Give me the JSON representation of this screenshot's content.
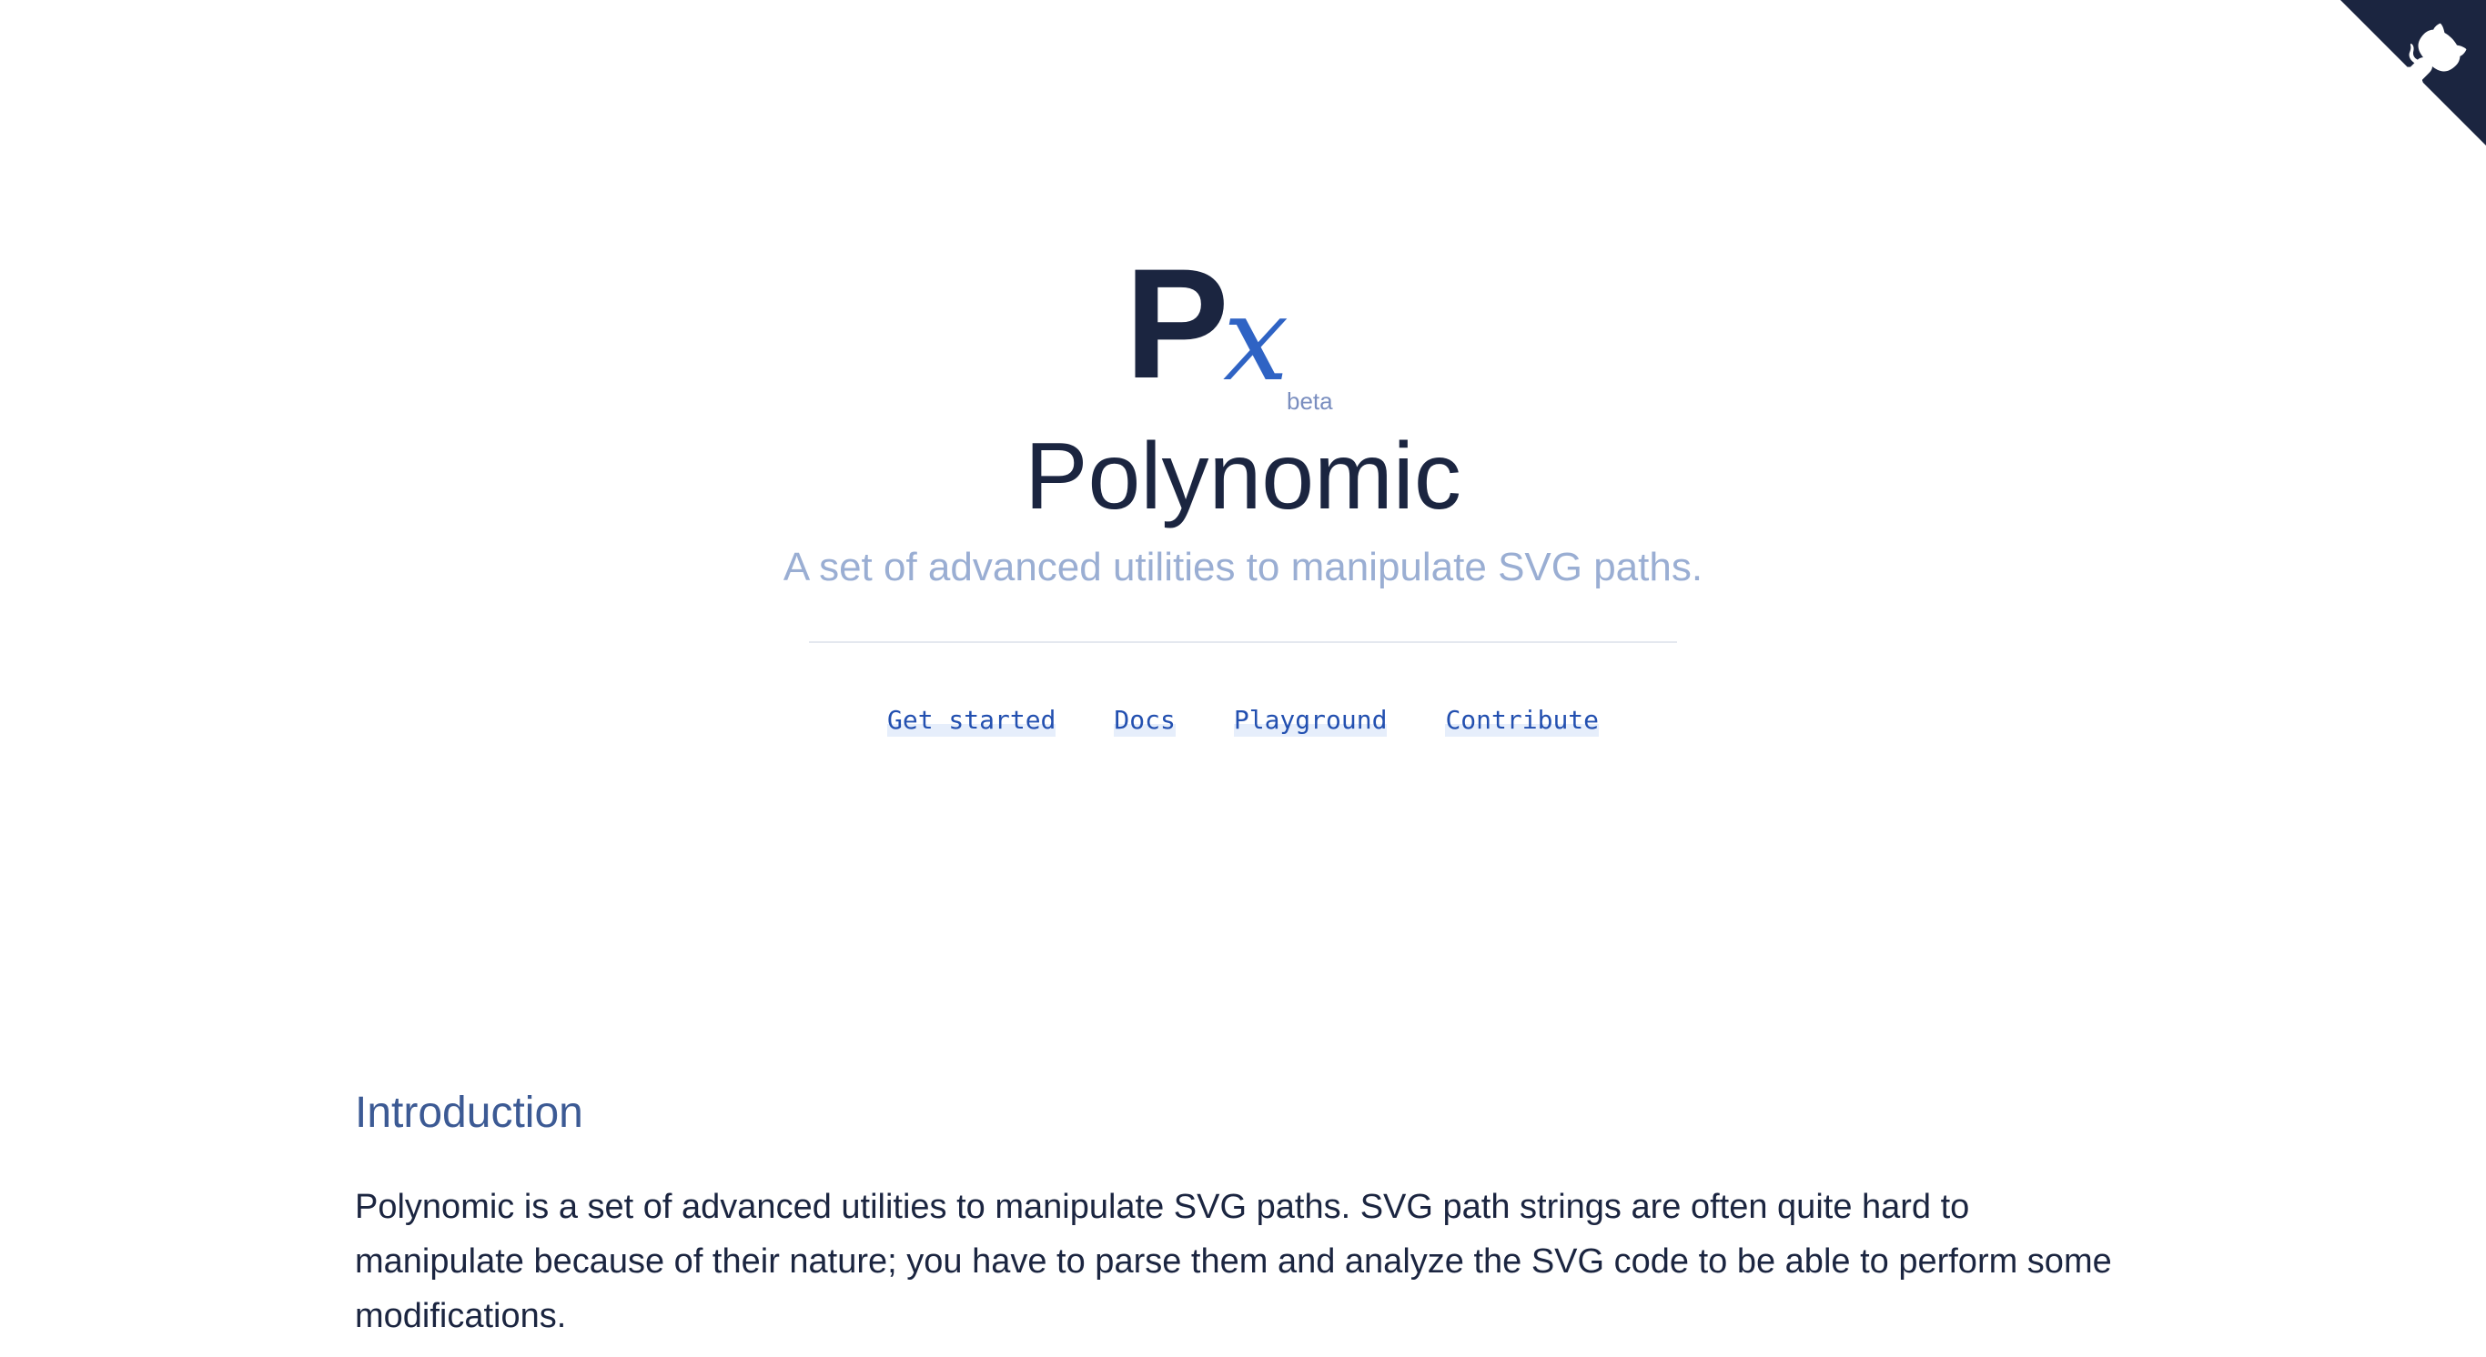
{
  "logo": {
    "letter": "P",
    "symbol": "x",
    "badge": "beta"
  },
  "hero": {
    "title": "Polynomic",
    "subtitle": "A set of advanced utilities to manipulate SVG paths."
  },
  "nav": {
    "items": [
      {
        "label": "Get started"
      },
      {
        "label": "Docs"
      },
      {
        "label": "Playground"
      },
      {
        "label": "Contribute"
      }
    ]
  },
  "github_corner": {
    "icon": "github-octocat-icon",
    "background": "#1b2540"
  },
  "introduction": {
    "heading": "Introduction",
    "paragraph": "Polynomic is a set of advanced utilities to manipulate SVG paths. SVG path strings are often quite hard to manipulate because of their nature; you have to parse them and analyze the SVG code to be able to perform some modifications."
  },
  "colors": {
    "text": "#1b2540",
    "accent": "#2f63c4",
    "subtitle": "#9aaed3",
    "heading": "#3c5a94",
    "link": "#2350b0"
  }
}
